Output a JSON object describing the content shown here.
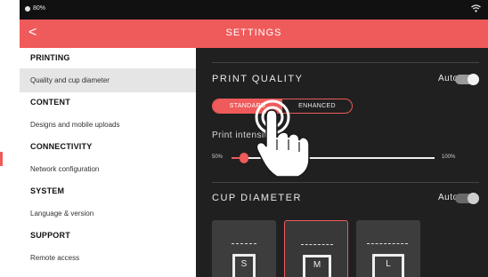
{
  "statusbar": {
    "battery": "80%"
  },
  "titlebar": {
    "back": "<",
    "title": "SETTINGS"
  },
  "sidebar": {
    "sections": [
      {
        "heading": "PRINTING",
        "item": "Quality and cup diameter"
      },
      {
        "heading": "CONTENT",
        "item": "Designs and mobile uploads"
      },
      {
        "heading": "CONNECTIVITY",
        "item": "Network configuration"
      },
      {
        "heading": "SYSTEM",
        "item": "Language & version"
      },
      {
        "heading": "SUPPORT",
        "item": "Remote access"
      }
    ]
  },
  "print_quality": {
    "title": "PRINT QUALITY",
    "auto_label": "Auto",
    "auto_on": true,
    "modes": [
      "STANDARD",
      "ENHANCED"
    ],
    "selected_mode": "STANDARD"
  },
  "print_intensity": {
    "label": "Print intensity",
    "min_label": "50%",
    "max_label": "100%",
    "value_fraction": 0.06
  },
  "cup_diameter": {
    "title": "CUP DIAMETER",
    "auto_label": "Auto",
    "auto_on": false,
    "sizes": [
      "S",
      "M",
      "L"
    ],
    "selected_size": "M"
  },
  "colors": {
    "accent": "#ef5a5a",
    "panel": "#202020",
    "sidebar_active": "#e5e5e5"
  }
}
